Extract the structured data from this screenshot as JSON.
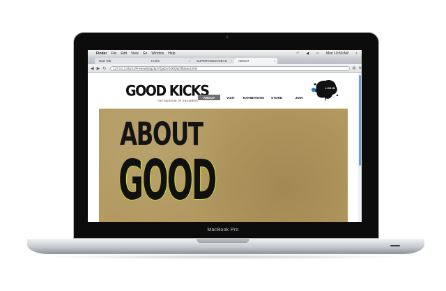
{
  "device": {
    "brand": "MacBook Pro"
  },
  "mac_menubar": {
    "app": "Finder",
    "menus": [
      "File",
      "Edit",
      "View",
      "Go",
      "Window",
      "Help"
    ],
    "clock": "Mon 10:50 AM"
  },
  "browser": {
    "tabs": [
      {
        "label": "New Tab"
      },
      {
        "label": "Home"
      },
      {
        "label": "SUPERVISED IDEAS"
      },
      {
        "label": "ABOUT"
      }
    ],
    "url": "127.0.0.1:55101/Preview/63qZ6pYfQaDo7ID0QW3fl/about.html"
  },
  "site": {
    "logo": "GOOD KICKS",
    "tagline": "THE MUSEUM OF SNEAKERS",
    "nav": [
      "ABOUT",
      "VISIT",
      "EXHIBITIONS",
      "STORE",
      "JOIN"
    ],
    "login": "LOG IN",
    "hero_line1": "ABOUT",
    "hero_line2": "GOOD KICKS"
  }
}
